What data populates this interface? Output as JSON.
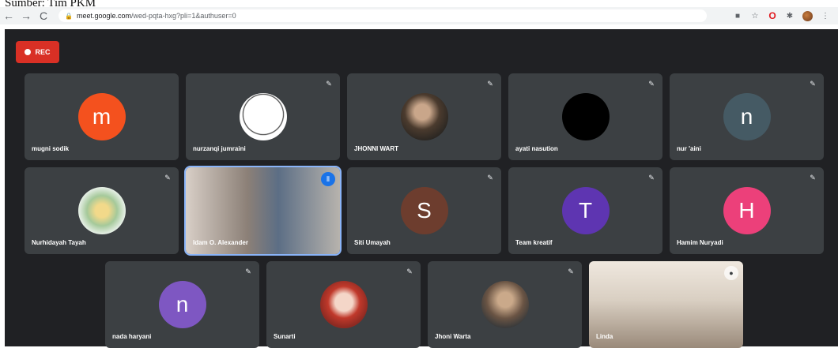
{
  "caption": "Sumber: Tim PKM",
  "browser": {
    "back": "←",
    "forward": "→",
    "reload": "C",
    "url_host": "meet.google.com",
    "url_path": "/wed-pqta-hxg?pli=1&authuser=0"
  },
  "rec_label": "REC",
  "participants": [
    {
      "name": "mugni sodik",
      "initial": "m",
      "color": "#f4511e",
      "type": "letter"
    },
    {
      "name": "nurzanqi jumraini",
      "initial": "",
      "type": "photo"
    },
    {
      "name": "JHONNI WART",
      "initial": "",
      "type": "photo"
    },
    {
      "name": "ayati nasution",
      "initial": "",
      "type": "photo"
    },
    {
      "name": "nur 'aini",
      "initial": "n",
      "color": "#455a64",
      "type": "letter"
    },
    {
      "name": "Nurhidayah Tayah",
      "initial": "",
      "type": "photo"
    },
    {
      "name": "Idam O. Alexander",
      "initial": "",
      "type": "video"
    },
    {
      "name": "Siti Umayah",
      "initial": "S",
      "color": "#6d3d2e",
      "type": "letter"
    },
    {
      "name": "Team kreatif",
      "initial": "T",
      "color": "#5e35b1",
      "type": "letter"
    },
    {
      "name": "Hamim Nuryadi",
      "initial": "H",
      "color": "#ec407a",
      "type": "letter"
    },
    {
      "name": "nada haryani",
      "initial": "n",
      "color": "#7e57c2",
      "type": "letter"
    },
    {
      "name": "Sunarti",
      "initial": "",
      "type": "photo"
    },
    {
      "name": "Jhoni Warta",
      "initial": "",
      "type": "photo"
    },
    {
      "name": "Linda",
      "initial": "",
      "type": "video"
    }
  ]
}
